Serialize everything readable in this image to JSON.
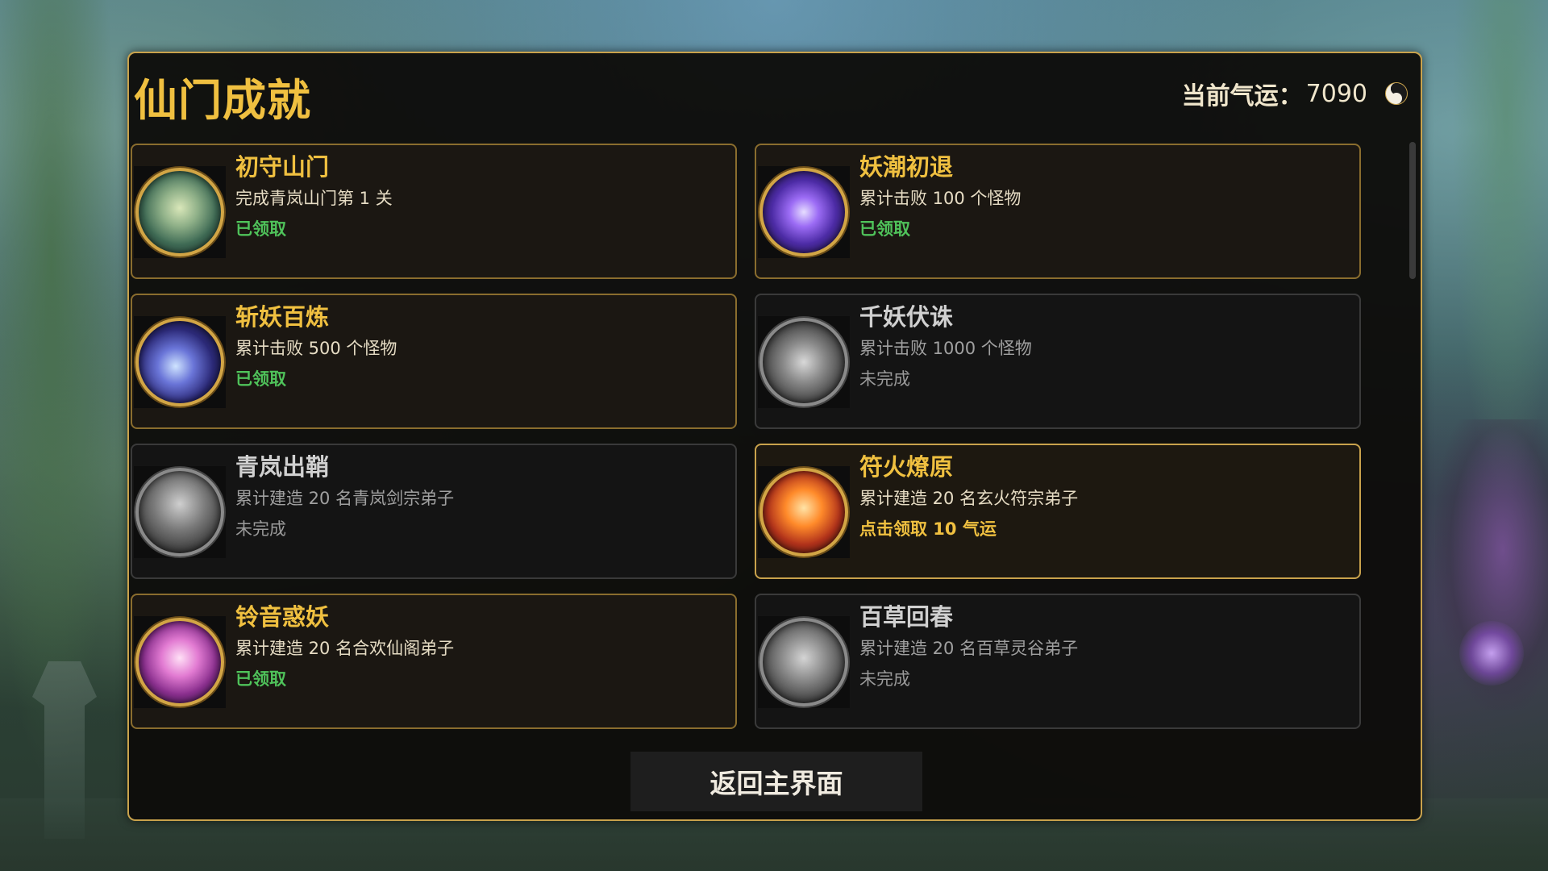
{
  "panel": {
    "title": "仙门成就",
    "fortune_label": "当前气运：",
    "fortune_value": "7090",
    "fortune_icon": "yin-yang-icon"
  },
  "achievements": [
    {
      "title": "初守山门",
      "desc": "完成青岚山门第 1 关",
      "status": "已领取",
      "state": "claimed",
      "badge": "gate-badge-icon"
    },
    {
      "title": "妖潮初退",
      "desc": "累计击败 100 个怪物",
      "status": "已领取",
      "state": "claimed",
      "badge": "sword-badge-icon"
    },
    {
      "title": "斩妖百炼",
      "desc": "累计击败 500 个怪物",
      "status": "已领取",
      "state": "claimed",
      "badge": "slash-badge-icon"
    },
    {
      "title": "千妖伏诛",
      "desc": "累计击败 1000 个怪物",
      "status": "未完成",
      "state": "incomplete",
      "badge": "demon-army-badge-icon"
    },
    {
      "title": "青岚出鞘",
      "desc": "累计建造 20 名青岚剑宗弟子",
      "status": "未完成",
      "state": "incomplete",
      "badge": "swordsman-badge-icon"
    },
    {
      "title": "符火燎原",
      "desc": "累计建造 20 名玄火符宗弟子",
      "status": "点击领取 10 气运",
      "state": "claimable",
      "badge": "fire-talisman-badge-icon"
    },
    {
      "title": "铃音惑妖",
      "desc": "累计建造 20 名合欢仙阁弟子",
      "status": "已领取",
      "state": "claimed",
      "badge": "bell-maiden-badge-icon"
    },
    {
      "title": "百草回春",
      "desc": "累计建造 20 名百草灵谷弟子",
      "status": "未完成",
      "state": "incomplete",
      "badge": "herbalist-badge-icon"
    }
  ],
  "back_button_label": "返回主界面",
  "colors": {
    "gold": "#f0c040",
    "border_gold": "#c9a24c",
    "claimed_green": "#4fc25a",
    "incomplete_grey": "#9a9a9a"
  }
}
